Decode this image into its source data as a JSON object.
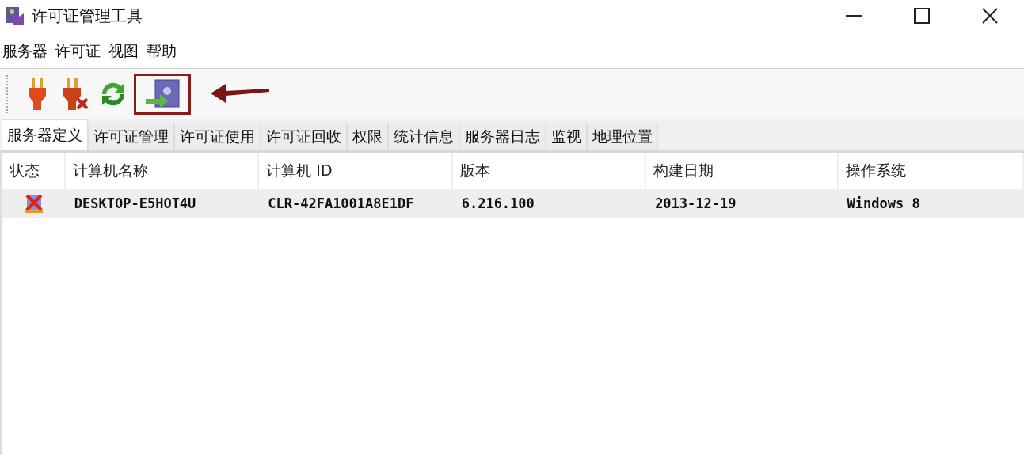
{
  "window": {
    "title": "许可证管理工具"
  },
  "menu": [
    "服务器",
    "许可证",
    "视图",
    "帮助"
  ],
  "toolbar": [
    {
      "kind": "connect",
      "highlighted": false
    },
    {
      "kind": "disconnect",
      "highlighted": false
    },
    {
      "kind": "refresh",
      "highlighted": false
    },
    {
      "kind": "import",
      "highlighted": true
    }
  ],
  "tabs": [
    {
      "label": "服务器定义",
      "selected": true
    },
    {
      "label": "许可证管理",
      "selected": false
    },
    {
      "label": "许可证使用",
      "selected": false
    },
    {
      "label": "许可证回收",
      "selected": false
    },
    {
      "label": "权限",
      "selected": false
    },
    {
      "label": "统计信息",
      "selected": false
    },
    {
      "label": "服务器日志",
      "selected": false
    },
    {
      "label": "监视",
      "selected": false
    },
    {
      "label": "地理位置",
      "selected": false
    }
  ],
  "table": {
    "columns": [
      "状态",
      "计算机名称",
      "计算机 ID",
      "版本",
      "构建日期",
      "操作系统"
    ],
    "rows": [
      {
        "kind": "stopped",
        "cells": [
          "",
          "DESKTOP-E5HOT4U",
          "CLR-42FA1001A8E1DF",
          "6.216.100",
          "2013-12-19",
          "Windows 8"
        ]
      }
    ]
  }
}
